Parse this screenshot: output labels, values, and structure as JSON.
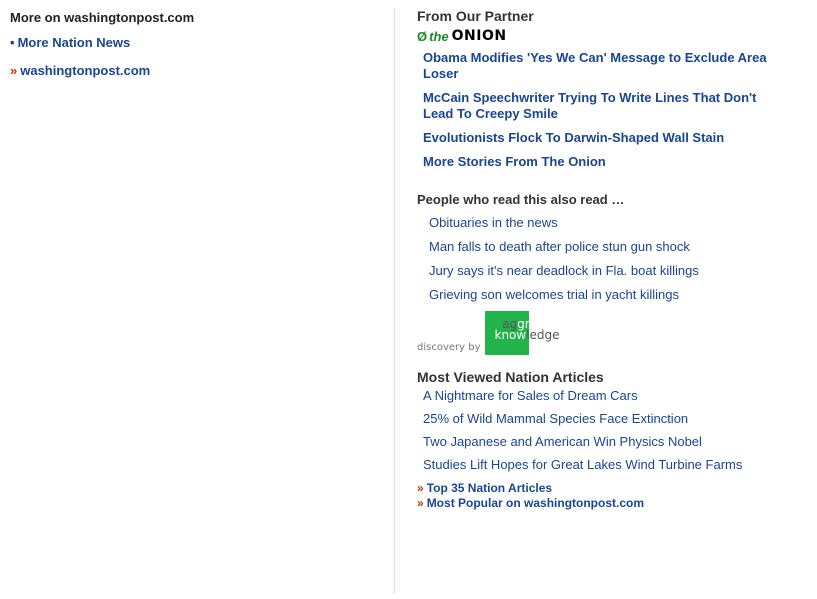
{
  "left": {
    "heading": "More on washingtonpost.com",
    "bullet_glyph": "•",
    "nation_news": "More Nation News",
    "raquo_glyph": "»",
    "site_link": "washingtonpost.com"
  },
  "partner": {
    "title": "From Our Partner",
    "logo_the": "the",
    "logo_name": "ONION",
    "leaf_icon": "leaf-icon",
    "stories": [
      "Obama Modifies 'Yes We Can' Message to Exclude Area Loser",
      "McCain Speechwriter Trying To Write Lines That Don't Lead To Creepy Smile",
      "Evolutionists Flock To Darwin-Shaped Wall Stain",
      "More Stories From The Onion"
    ]
  },
  "people": {
    "title": "People who read this also read …",
    "items": [
      "Obituaries in the news",
      "Man falls to death after police stun gun shock",
      "Jury says it's near deadlock in Fla. boat killings",
      "Grieving son welcomes trial in yacht killings"
    ],
    "discovery_by": "discovery by",
    "ak_line1_dark": "ag",
    "ak_line1_light": "gregate",
    "ak_line2_light": "know",
    "ak_line2_dark": "ledge"
  },
  "most_viewed": {
    "title": "Most Viewed Nation Articles",
    "items": [
      "A Nightmare for Sales of Dream Cars",
      "25% of Wild Mammal Species Face Extinction",
      "Two Japanese and American Win Physics Nobel",
      "Studies Lift Hopes for Great Lakes Wind Turbine Farms"
    ],
    "raquo_glyph": "»",
    "top35": "Top 35 Nation Articles",
    "popular": "Most Popular on washingtonpost.com"
  },
  "colors": {
    "link": "#1a4591",
    "raquo": "#cc3300",
    "onion_green": "#1f8a2c",
    "ak_green": "#22b34a"
  }
}
